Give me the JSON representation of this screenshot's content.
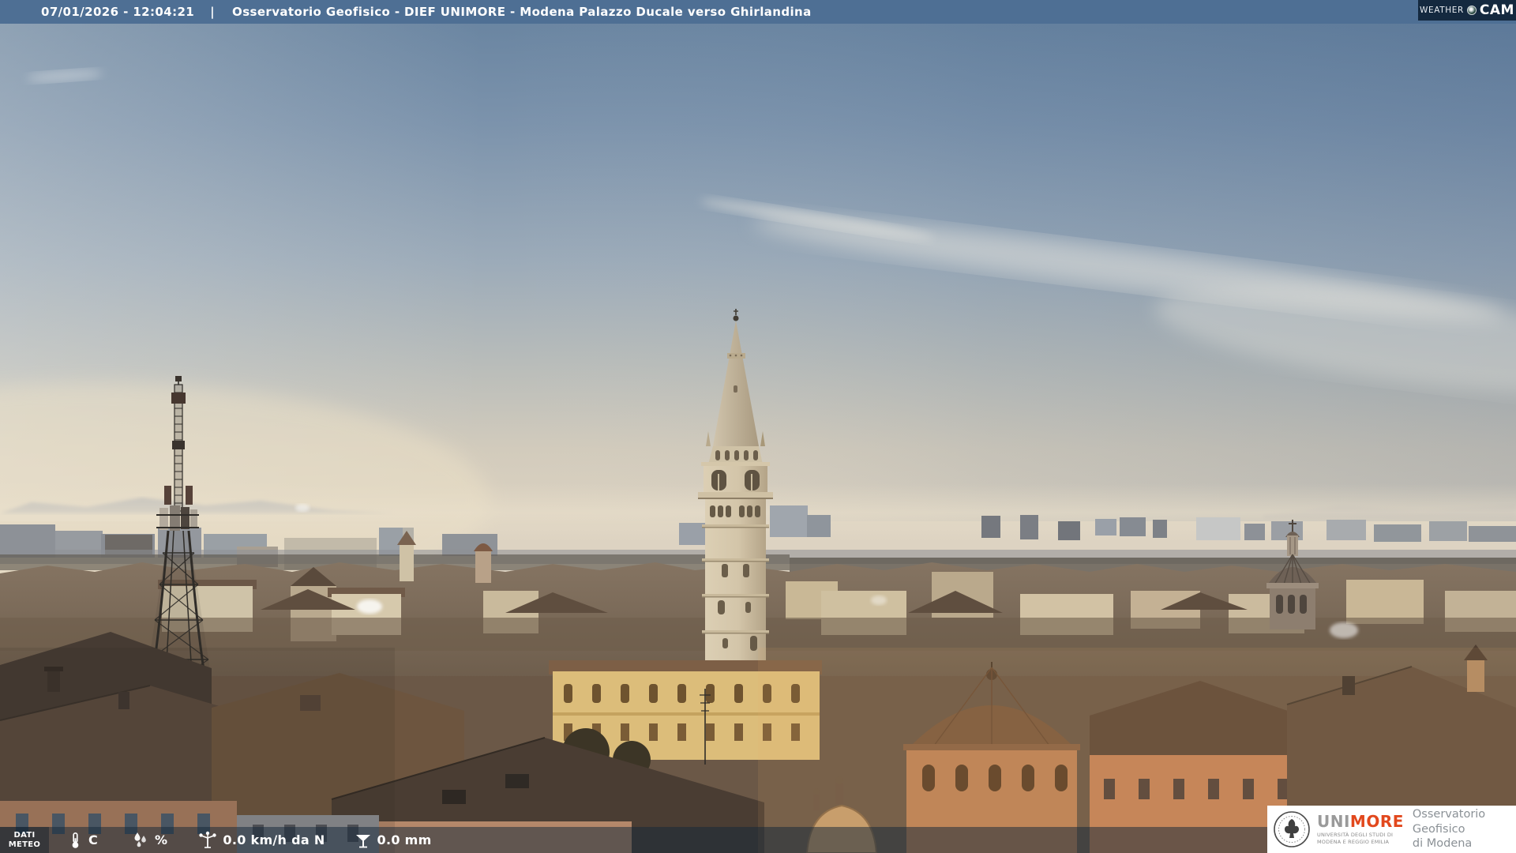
{
  "top_bar": {
    "datetime": "07/01/2026 - 12:04:21",
    "separator": "|",
    "title": "Osservatorio Geofisico - DIEF UNIMORE - Modena Palazzo Ducale verso Ghirlandina"
  },
  "weathercam": {
    "word1": "WEATHER",
    "word2": "CAM"
  },
  "meteo_bar": {
    "label_line1": "DATI",
    "label_line2": "METEO",
    "temperature": "C",
    "humidity": "%",
    "wind": "0.0 km/h da N",
    "rain": "0.0 mm"
  },
  "unimore_logo": {
    "brand_prefix": "UNI",
    "brand_suffix": "MORE",
    "subtitle_line1": "UNIVERSITÀ DEGLI STUDI DI",
    "subtitle_line2": "MODENA E REGGIO EMILIA",
    "org_line1": "Osservatorio Geofisico",
    "org_line2": "di Modena"
  },
  "colors": {
    "top_bar_bg": "#4e6f94",
    "weathercam_bg": "#14293f",
    "meteo_bar_bg": "rgba(22,40,58,0.52)",
    "unimore_red": "#e2481d",
    "unimore_gray": "#9a9a9a",
    "org_text_gray": "#8b9196"
  }
}
